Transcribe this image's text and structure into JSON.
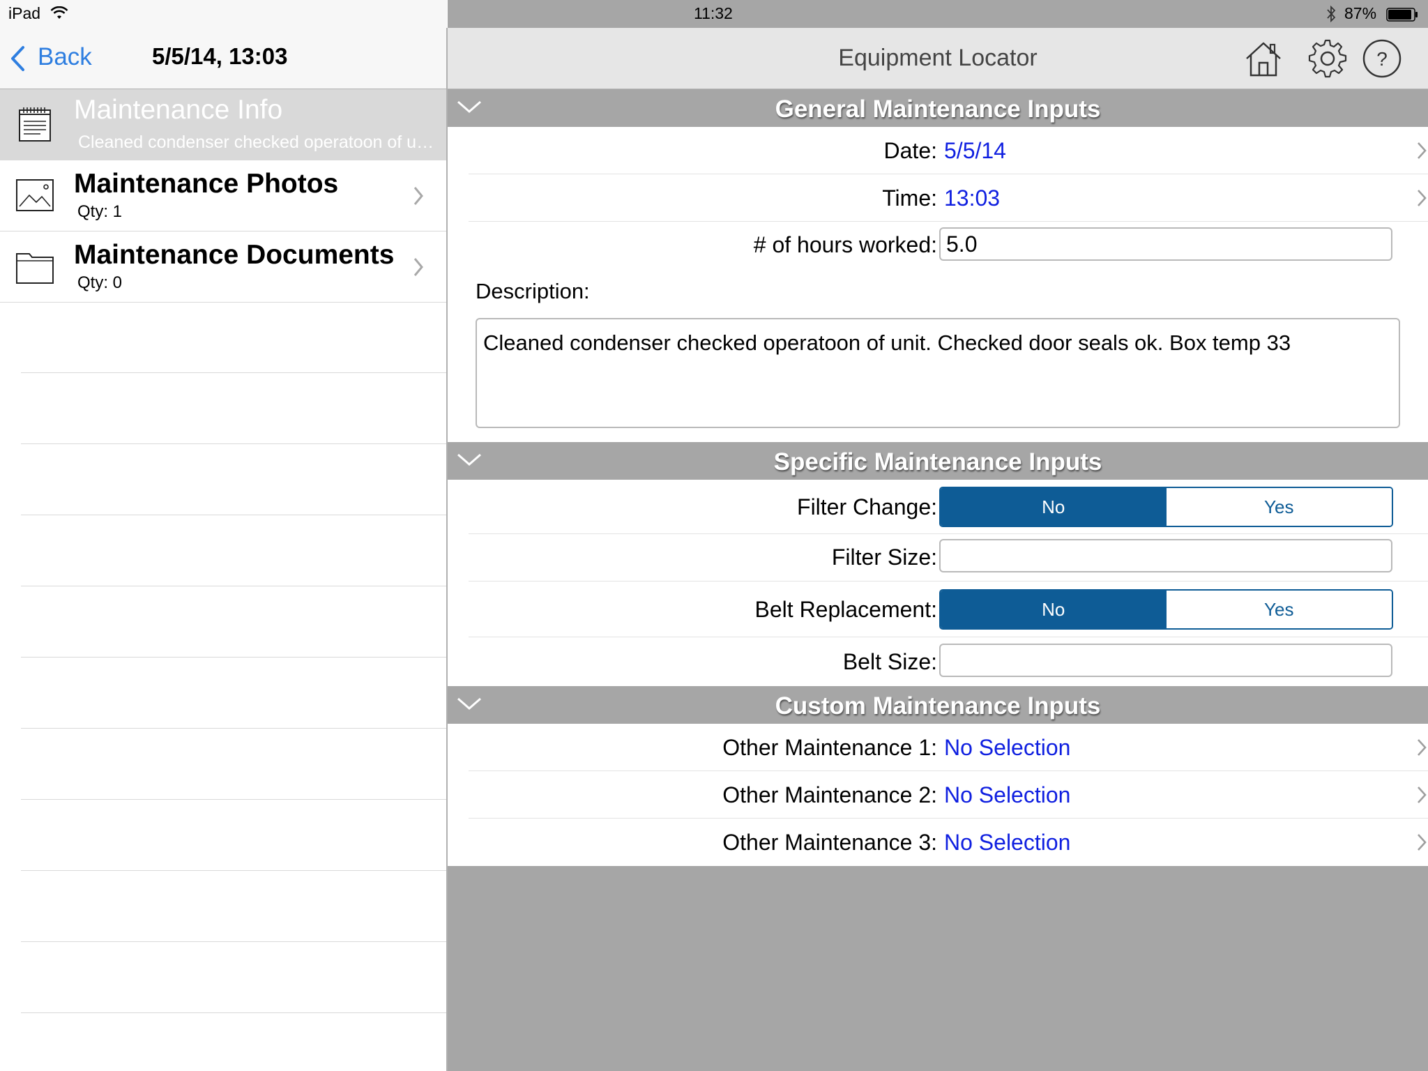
{
  "status_bar": {
    "device": "iPad",
    "time": "11:32",
    "battery": "87%"
  },
  "left": {
    "back_label": "Back",
    "title": "5/5/14, 13:03",
    "items": [
      {
        "title": "Maintenance Info",
        "subtitle": "Cleaned condenser checked operatoon of unit. Checked door seals ok. Box temp 33",
        "icon": "notepad-icon",
        "selected": true
      },
      {
        "title": "Maintenance Photos",
        "subtitle": "Qty: 1",
        "icon": "photo-icon",
        "selected": false
      },
      {
        "title": "Maintenance Documents",
        "subtitle": "Qty: 0",
        "icon": "folder-icon",
        "selected": false
      }
    ]
  },
  "right": {
    "app_title": "Equipment Locator",
    "general": {
      "header": "General Maintenance Inputs",
      "date_label": "Date:",
      "date_value": "5/5/14",
      "time_label": "Time:",
      "time_value": "13:03",
      "hours_label": "# of hours worked:",
      "hours_value": "5.0",
      "description_label": "Description:",
      "description_value": "Cleaned condenser checked operatoon of unit. Checked door seals ok. Box temp 33"
    },
    "specific": {
      "header": "Specific Maintenance Inputs",
      "filter_change_label": "Filter Change:",
      "filter_size_label": "Filter Size:",
      "filter_size_value": "",
      "belt_replacement_label": "Belt Replacement:",
      "belt_size_label": "Belt Size:",
      "belt_size_value": "",
      "no_label": "No",
      "yes_label": "Yes",
      "filter_change_selected": "No",
      "belt_replacement_selected": "No"
    },
    "custom": {
      "header": "Custom Maintenance Inputs",
      "rows": [
        {
          "label": "Other Maintenance 1:",
          "value": "No Selection"
        },
        {
          "label": "Other Maintenance 2:",
          "value": "No Selection"
        },
        {
          "label": "Other Maintenance 3:",
          "value": "No Selection"
        }
      ]
    }
  },
  "colors": {
    "accent_blue": "#0e5c96",
    "link_blue": "#0f1fe0",
    "ios_blue": "#2e7ee0",
    "header_gray": "#a6a6a6"
  }
}
